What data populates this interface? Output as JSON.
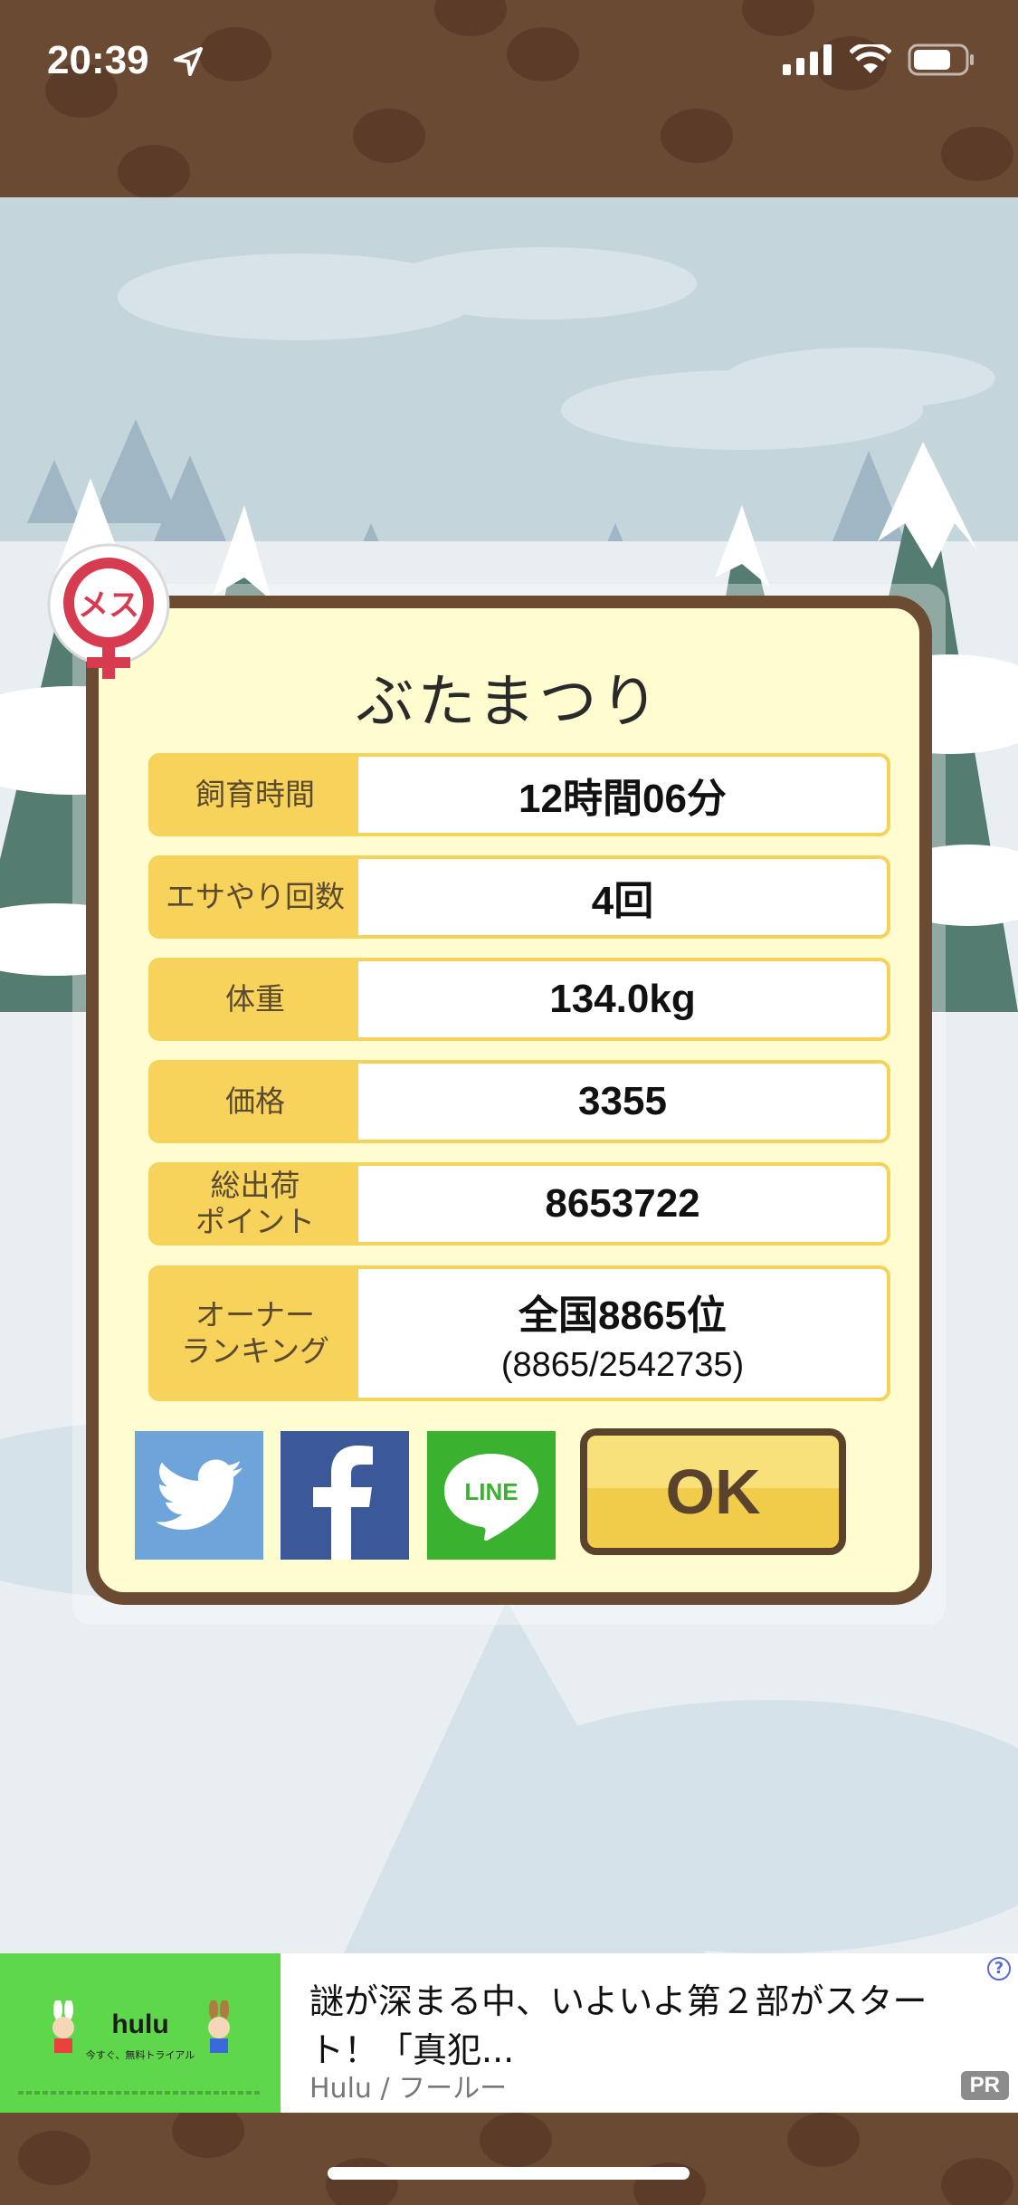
{
  "status_bar": {
    "time": "20:39"
  },
  "dialog": {
    "title": "ぶたまつり",
    "gender_badge": "メス",
    "rows": [
      {
        "label": "飼育時間",
        "value": "12時間06分"
      },
      {
        "label": "エサやり回数",
        "value": "4回"
      },
      {
        "label": "体重",
        "value": "134.0kg"
      },
      {
        "label": "価格",
        "value": "3355"
      },
      {
        "label": "総出荷\nポイント",
        "value": "8653722"
      },
      {
        "label": "オーナー\nランキング",
        "value": "全国8865位",
        "sub": "(8865/2542735)"
      }
    ],
    "share": {
      "twitter": "twitter-icon",
      "facebook": "facebook-icon",
      "line": "LINE"
    },
    "ok_label": "OK"
  },
  "ad": {
    "brand": "hulu",
    "tagline": "今すぐ、無料トライアル",
    "text": "謎が深まる中、いよいよ第２部がスタート！「真犯...",
    "source": "Hulu / フールー",
    "pr": "PR",
    "info": "?"
  },
  "colors": {
    "accent": "#f8d35b",
    "frame": "#6b4b32",
    "panel": "#fffdcf"
  }
}
